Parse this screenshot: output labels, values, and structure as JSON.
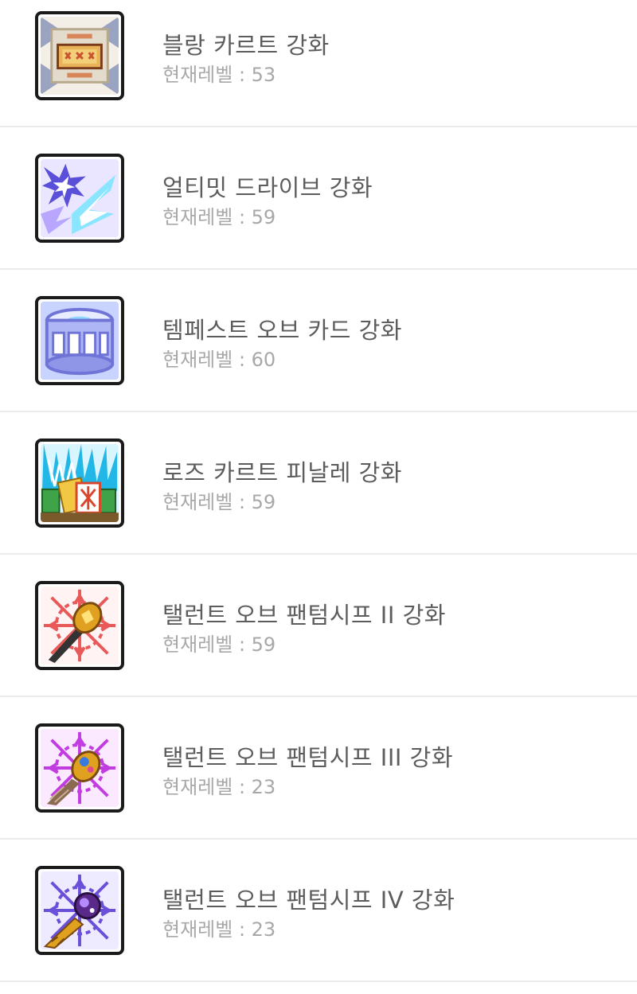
{
  "skills": [
    {
      "title": "블랑 카르트 강화",
      "level": "현재레벨 : 53",
      "icon": "blanc-carte-icon",
      "colors": [
        "#9aa3bf",
        "#e9c27a",
        "#c8552f",
        "#f0e6d0"
      ]
    },
    {
      "title": "얼티밋 드라이브 강화",
      "level": "현재레벨 : 59",
      "icon": "ultimate-drive-icon",
      "colors": [
        "#5a4fd8",
        "#7fe6ff",
        "#ffffff",
        "#b9a6ff"
      ]
    },
    {
      "title": "템페스트 오브 카드 강화",
      "level": "현재레벨 : 60",
      "icon": "tempest-of-card-icon",
      "colors": [
        "#6f74d6",
        "#c9d3ff",
        "#ffffff",
        "#8fd8ff"
      ]
    },
    {
      "title": "로즈 카르트 피날레 강화",
      "level": "현재레벨 : 59",
      "icon": "rose-carte-finale-icon",
      "colors": [
        "#22b7e6",
        "#f2c744",
        "#d9462b",
        "#3fa34a"
      ]
    },
    {
      "title": "탤런트 오브 팬텀시프 II 강화",
      "level": "현재레벨 : 59",
      "icon": "talent-of-phantom-thief-2-icon",
      "colors": [
        "#e85a5a",
        "#ffd6d6",
        "#e0a020",
        "#333333"
      ]
    },
    {
      "title": "탤런트 오브 팬텀시프 III 강화",
      "level": "현재레벨 : 23",
      "icon": "talent-of-phantom-thief-3-icon",
      "colors": [
        "#c23de0",
        "#f5d0ff",
        "#e0a020",
        "#8a6a50"
      ]
    },
    {
      "title": "탤런트 오브 팬텀시프 IV 강화",
      "level": "현재레벨 : 23",
      "icon": "talent-of-phantom-thief-4-icon",
      "colors": [
        "#6a4fd8",
        "#d8d0ff",
        "#e0a020",
        "#5a2a8a"
      ]
    }
  ]
}
